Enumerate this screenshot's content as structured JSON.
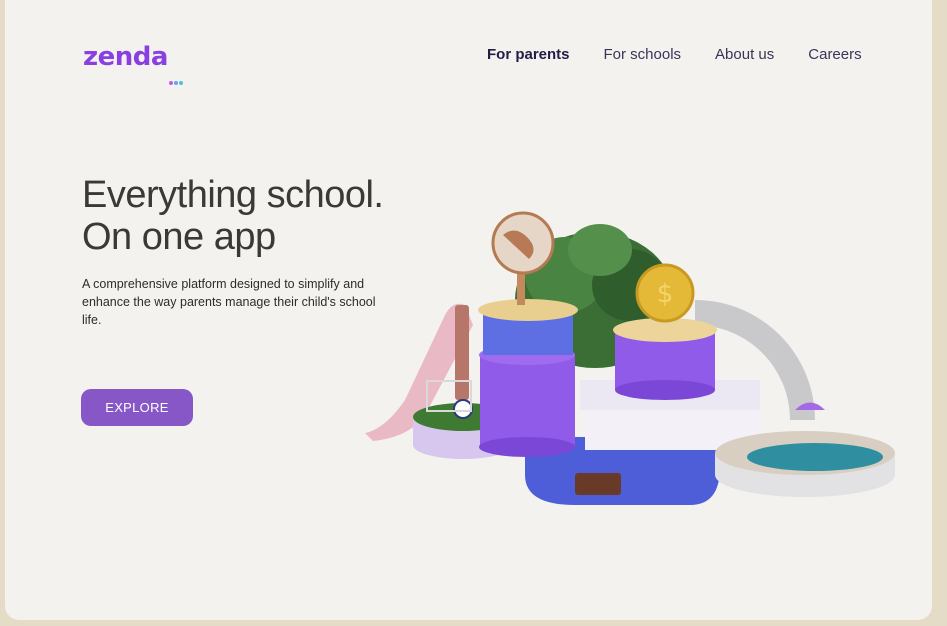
{
  "brand": {
    "name": "zenda",
    "logo_color": "#8a3fe0",
    "dot_colors": [
      "#c35ce8",
      "#6aa0f2",
      "#4cc3e0"
    ]
  },
  "nav": {
    "items": [
      {
        "label": "For parents",
        "active": true
      },
      {
        "label": "For schools",
        "active": false
      },
      {
        "label": "About us",
        "active": false
      },
      {
        "label": "Careers",
        "active": false
      }
    ]
  },
  "hero": {
    "title_line1": "Everything school.",
    "title_line2": "On one app",
    "description": "A comprehensive platform designed to simplify and enhance the way parents manage their child's school life.",
    "cta_label": "EXPLORE",
    "cta_color": "#8757c8"
  },
  "illustration": {
    "icon": "school-campus-3d-illustration",
    "accent_colors": [
      "#8a5be6",
      "#5b6ae0",
      "#e8c95a",
      "#3c7a3a",
      "#2f8fa0",
      "#e7b7c8"
    ]
  }
}
